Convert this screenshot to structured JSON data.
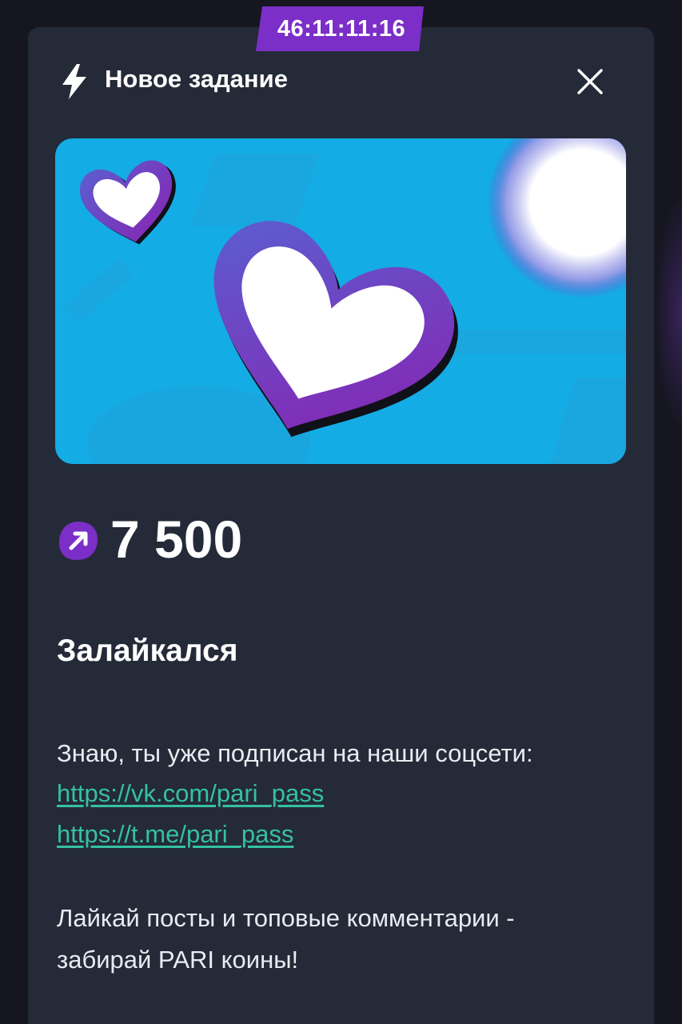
{
  "timer": {
    "value": "46:11:11:16"
  },
  "header": {
    "icon": "lightning-bolt-icon",
    "title": "Новое задание",
    "close_icon": "close-icon"
  },
  "banner": {
    "image": "hearts-illustration",
    "colors": {
      "background": "#14ace4",
      "heart_outline": "#7b2ec8",
      "heart_fill": "#ffffff"
    }
  },
  "reward": {
    "icon": "pari-coin-icon",
    "amount": "7 500"
  },
  "task": {
    "title": "Залайкался",
    "intro": "Знаю, ты уже подписан на наши соцсети:",
    "links": [
      "https://vk.com/pari_pass",
      "https://t.me/pari_pass"
    ],
    "body_line1": "Лайкай посты и топовые комментарии -",
    "body_line2": "забирай PARI коины!"
  },
  "colors": {
    "background": "#15161f",
    "card": "#252a38",
    "accent_purple": "#7b2ec8",
    "link": "#34c1a3"
  }
}
